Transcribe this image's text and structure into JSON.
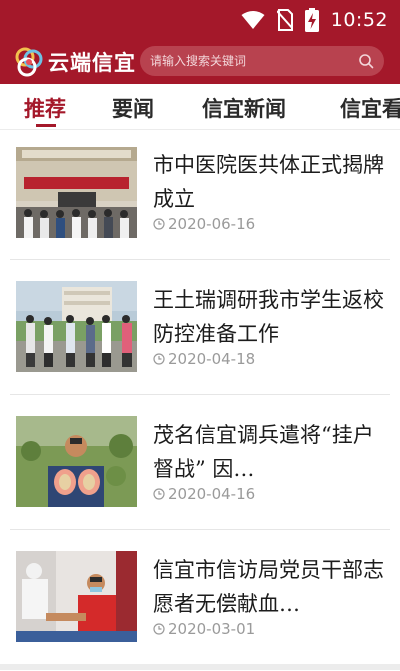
{
  "status_bar": {
    "time": "10:52",
    "icons": [
      "wifi-icon",
      "no-sim-icon",
      "battery-charging-icon"
    ]
  },
  "header": {
    "app_name": "云端信宜",
    "search_placeholder": "请输入搜索关键词",
    "search_icon": "search-icon",
    "colors": {
      "brand": "#a4182a",
      "search_bg": "#b8424f"
    }
  },
  "tabs": [
    {
      "label": "推荐",
      "active": true
    },
    {
      "label": "要闻",
      "active": false
    },
    {
      "label": "信宜新闻",
      "active": false
    },
    {
      "label": "信宜看",
      "active": false
    }
  ],
  "news": [
    {
      "title": "市中医院医共体正式揭牌成立",
      "date": "2020-06-16",
      "thumb": "ceremony-photo"
    },
    {
      "title": "王土瑞调研我市学生返校防控准备工作",
      "date": "2020-04-18",
      "thumb": "officials-visit-photo"
    },
    {
      "title": "茂名信宜调兵遣将“挂户督战” 因…",
      "date": "2020-04-16",
      "thumb": "fruit-farmer-photo"
    },
    {
      "title": "信宜市信访局党员干部志愿者无偿献血…",
      "date": "2020-03-01",
      "thumb": "blood-donation-photo"
    }
  ]
}
